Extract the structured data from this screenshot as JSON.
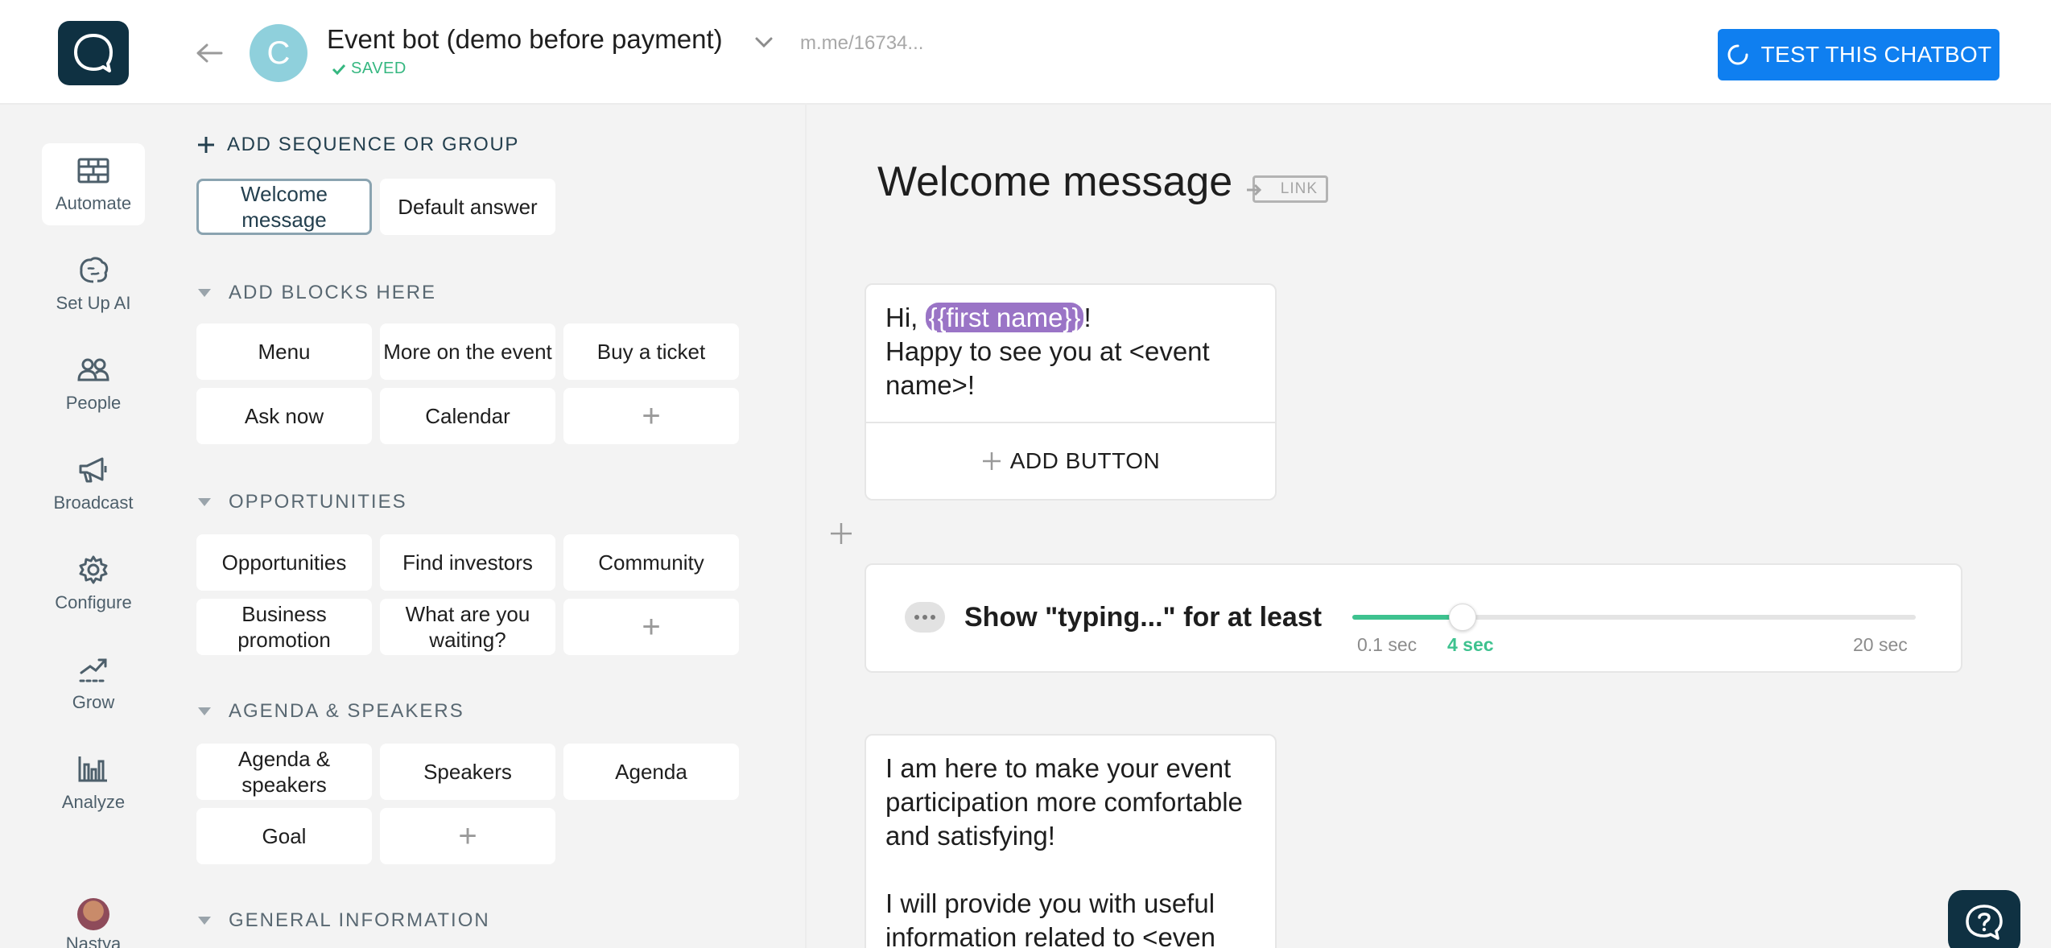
{
  "header": {
    "bot_avatar_letter": "C",
    "bot_name": "Event bot (demo before payment)",
    "saved_status": "SAVED",
    "bot_link": "m.me/16734...",
    "test_button_label": "TEST THIS CHATBOT",
    "colors": {
      "accent": "#0f7ff0",
      "brand_dark": "#0f3142",
      "saved_green": "#35b780"
    }
  },
  "nav": {
    "items": [
      {
        "label": "Automate",
        "icon": "bricks-icon",
        "active": true
      },
      {
        "label": "Set Up AI",
        "icon": "brain-icon"
      },
      {
        "label": "People",
        "icon": "people-icon"
      },
      {
        "label": "Broadcast",
        "icon": "megaphone-icon"
      },
      {
        "label": "Configure",
        "icon": "gear-icon"
      },
      {
        "label": "Grow",
        "icon": "trend-icon"
      },
      {
        "label": "Analyze",
        "icon": "bar-chart-icon"
      }
    ],
    "user_name": "Nastya"
  },
  "panel": {
    "add_sequence_label": "ADD SEQUENCE OR GROUP",
    "top_blocks": [
      "Welcome message",
      "Default answer"
    ],
    "sections": [
      {
        "title": "ADD BLOCKS HERE",
        "blocks": [
          "Menu",
          "More on the event",
          "Buy a ticket",
          "Ask now",
          "Calendar"
        ]
      },
      {
        "title": "OPPORTUNITIES",
        "blocks": [
          "Opportunities",
          "Find investors",
          "Community",
          "Business promotion",
          "What are you waiting?"
        ]
      },
      {
        "title": "AGENDA & SPEAKERS",
        "blocks": [
          "Agenda & speakers",
          "Speakers",
          "Agenda",
          "Goal"
        ]
      },
      {
        "title": "GENERAL INFORMATION",
        "blocks": []
      }
    ],
    "add_symbol": "+"
  },
  "editor": {
    "title": "Welcome message",
    "link_label": "LINK",
    "card1": {
      "greeting": "Hi, ",
      "variable": "{{first name}}",
      "after_variable": "!",
      "line2": "Happy to see you at <event name>!",
      "add_button_label": "ADD BUTTON"
    },
    "typing": {
      "label": "Show \"typing...\" for at least",
      "min_label": "0.1 sec",
      "current_label": "4 sec",
      "max_label": "20 sec",
      "min": 0.1,
      "max": 20,
      "value": 4
    },
    "card2": {
      "paragraph1": "I am here to make your event participation more comfortable and satisfying!",
      "paragraph2": "I will provide you with useful information related to <even"
    }
  }
}
